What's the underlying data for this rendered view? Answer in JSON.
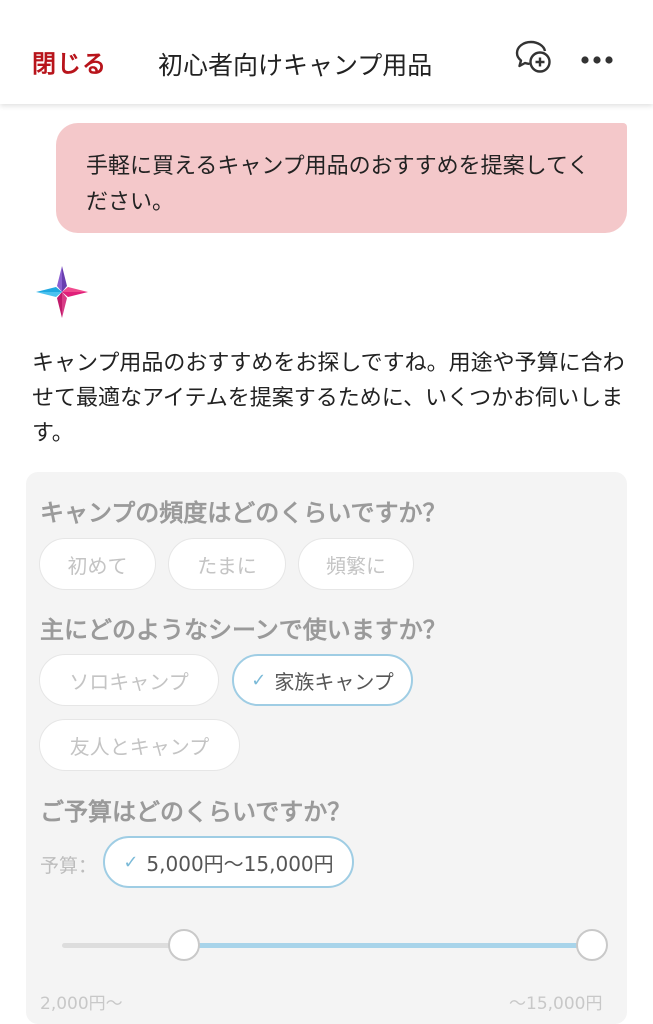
{
  "header": {
    "close_label": "閉じる",
    "title": "初心者向けキャンプ用品",
    "icons": [
      "chat-add-icon",
      "more-icon"
    ]
  },
  "user_message": "手軽に買えるキャンプ用品のおすすめを提案してください。",
  "ai_message": "キャンプ用品のおすすめをお探しですね。用途や予算に合わせて最適なアイテムを提案するために、いくつかお伺いします。",
  "form": {
    "q_frequency": {
      "question": "キャンプの頻度はどのくらいですか？",
      "options": [
        "初めて",
        "たまに",
        "頻繁に"
      ],
      "selected": null
    },
    "q_scene": {
      "question": "主にどのようなシーンで使いますか？",
      "options": [
        "ソロキャンプ",
        "家族キャンプ",
        "友人とキャンプ"
      ],
      "selected": "家族キャンプ"
    },
    "q_budget": {
      "question": "ご予算はどのくらいですか？",
      "label": "予算：",
      "selected_label": "5,000円〜15,000円",
      "min_label": "2,000円〜",
      "max_label": "〜15,000円",
      "range_min_value": 2000,
      "range_max_value": 15000,
      "selected_low": 5000,
      "selected_high": 15000
    }
  },
  "colors": {
    "accent_red": "#b8141b",
    "user_bubble": "#f4c8ca",
    "selected_border": "#9fcde4",
    "slider_fill": "#a8d4ea"
  }
}
